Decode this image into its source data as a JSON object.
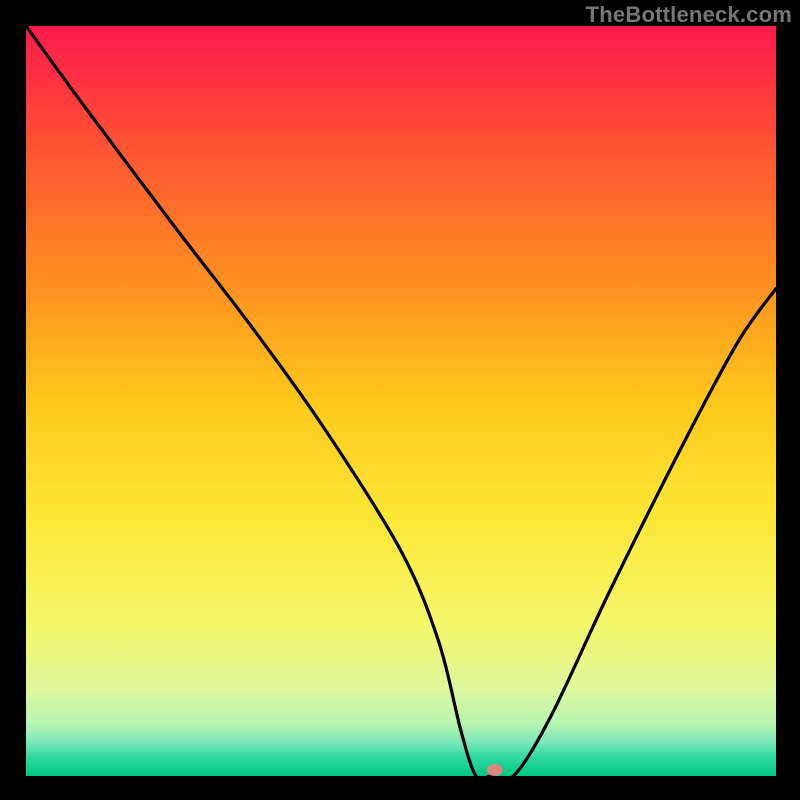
{
  "watermark": "TheBottleneck.com",
  "chart_data": {
    "type": "line",
    "title": "",
    "xlabel": "",
    "ylabel": "",
    "xlim": [
      0,
      100
    ],
    "ylim": [
      0,
      100
    ],
    "series": [
      {
        "name": "curve",
        "x": [
          0,
          8,
          20,
          30,
          40,
          50,
          55,
          58,
          60,
          62,
          65,
          70,
          78,
          88,
          95,
          100
        ],
        "y": [
          100,
          89,
          73,
          60,
          46,
          30,
          18,
          6,
          0,
          0,
          0,
          8,
          25,
          45,
          58,
          65
        ]
      }
    ],
    "marker": {
      "x": 62.5,
      "y": 0.8
    },
    "gradient_stops": [
      {
        "offset": 0,
        "color": "#ff1a4d"
      },
      {
        "offset": 0.05,
        "color": "#ff2a44"
      },
      {
        "offset": 0.18,
        "color": "#ff5a30"
      },
      {
        "offset": 0.35,
        "color": "#ff9220"
      },
      {
        "offset": 0.5,
        "color": "#ffc81a"
      },
      {
        "offset": 0.65,
        "color": "#fde734"
      },
      {
        "offset": 0.8,
        "color": "#f4f86a"
      },
      {
        "offset": 0.88,
        "color": "#e0f89a"
      },
      {
        "offset": 0.93,
        "color": "#b8f5b0"
      },
      {
        "offset": 0.955,
        "color": "#7ae8b8"
      },
      {
        "offset": 0.975,
        "color": "#30d8a0"
      },
      {
        "offset": 1.0,
        "color": "#00c884"
      }
    ]
  }
}
